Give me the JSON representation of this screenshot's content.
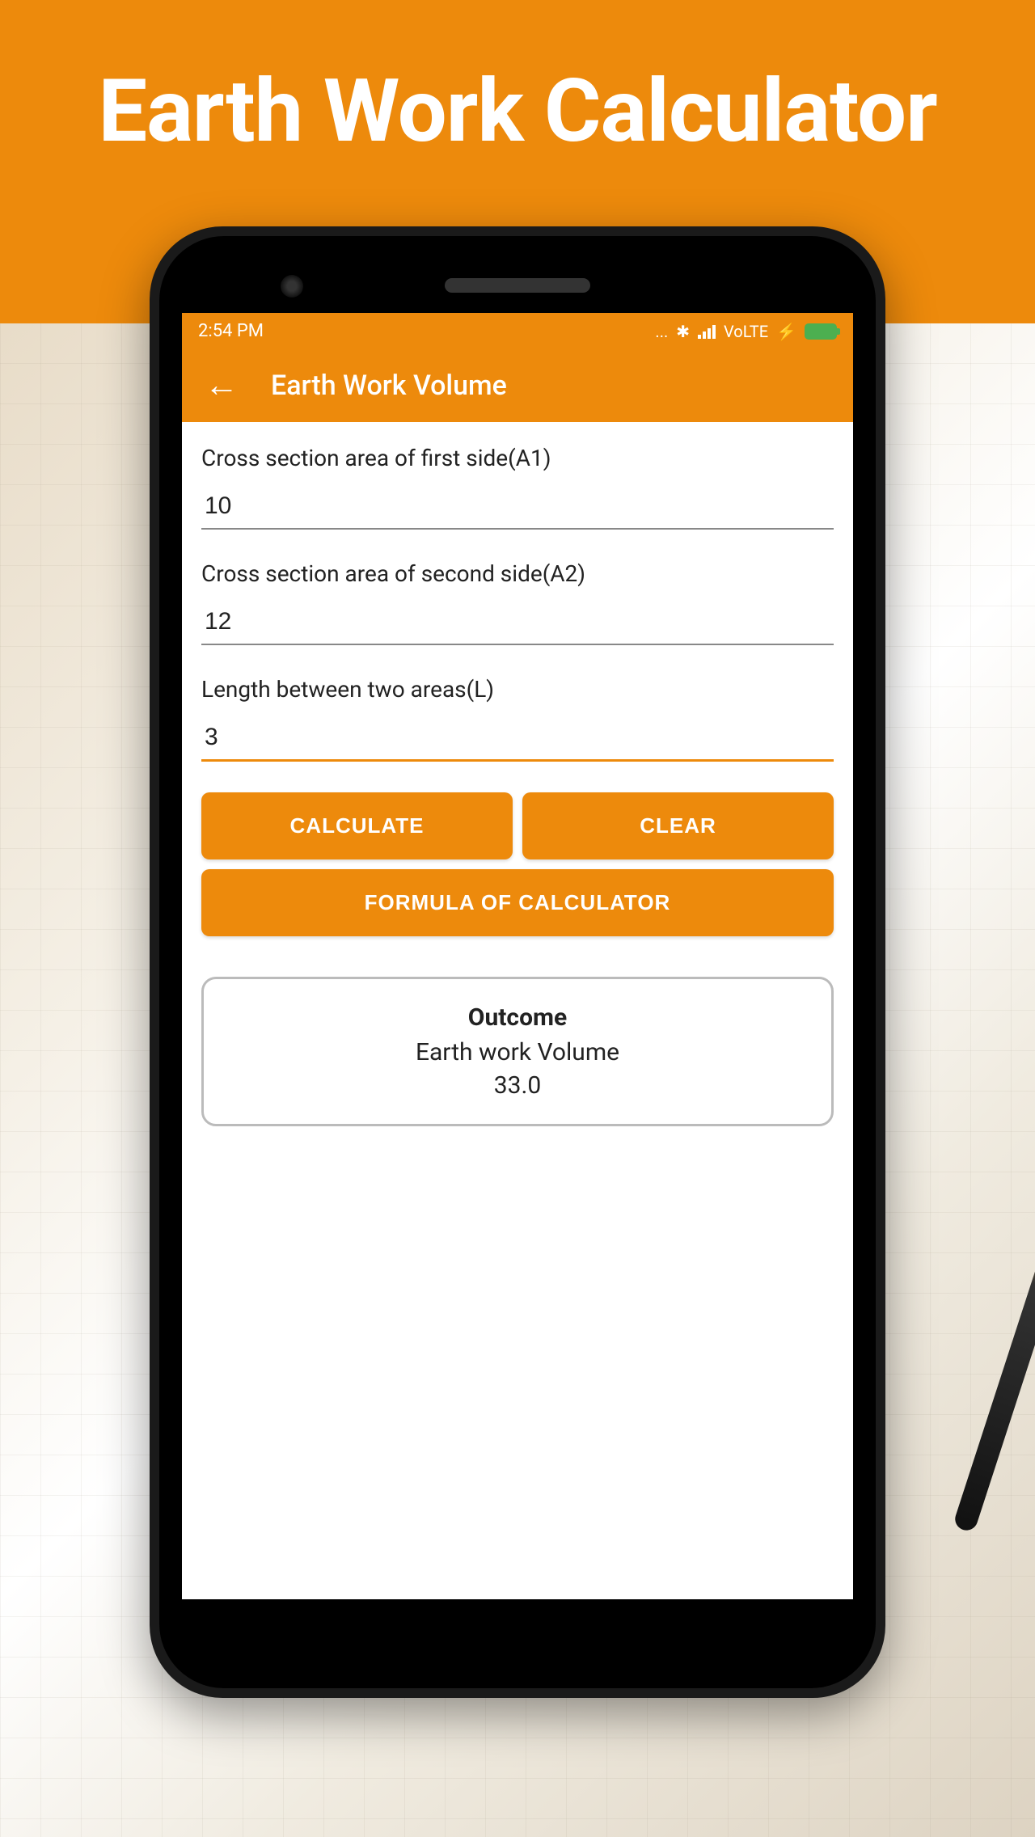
{
  "banner": {
    "title": "Earth Work Calculator"
  },
  "status_bar": {
    "time": "2:54 PM",
    "dots": "...",
    "volte": "VoLTE",
    "charging": "⚡"
  },
  "app_bar": {
    "title": "Earth Work Volume"
  },
  "fields": {
    "a1": {
      "label": "Cross section area of first side(A1)",
      "value": "10"
    },
    "a2": {
      "label": "Cross section area of second side(A2)",
      "value": "12"
    },
    "l": {
      "label": "Length between two areas(L)",
      "value": "3"
    }
  },
  "buttons": {
    "calculate": "CALCULATE",
    "clear": "CLEAR",
    "formula": "FORMULA OF CALCULATOR"
  },
  "outcome": {
    "title": "Outcome",
    "label": "Earth work Volume",
    "value": "33.0"
  }
}
